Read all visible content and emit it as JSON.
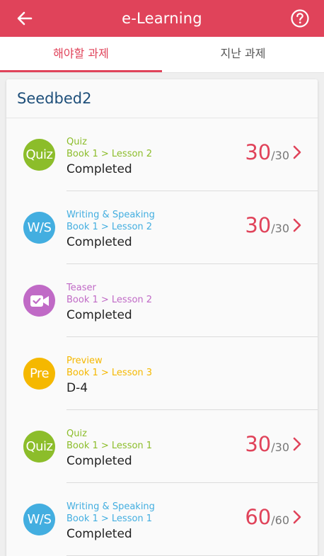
{
  "header": {
    "title": "e-Learning",
    "back_icon": "arrow-left-icon",
    "help_icon": "help-circle-icon",
    "color": "#e0435a"
  },
  "tabs": [
    {
      "label": "해야할 과제",
      "active": true
    },
    {
      "label": "지난 과제",
      "active": false
    }
  ],
  "course": {
    "title": "Seedbed2"
  },
  "items": [
    {
      "icon_text": "Quiz",
      "icon_color": "#8cbd2a",
      "category": "Quiz",
      "path": "Book 1 > Lesson 2",
      "status": "Completed",
      "score": "30",
      "total": "/30",
      "accent": "#8cbd2a"
    },
    {
      "icon_text": "W/S",
      "icon_color": "#43aee0",
      "category": "Writing & Speaking",
      "path": "Book 1 > Lesson 2",
      "status": "Completed",
      "score": "30",
      "total": "/30",
      "accent": "#43aee0"
    },
    {
      "icon_text": "",
      "icon_name": "video-check-icon",
      "icon_color": "#c06ac6",
      "category": "Teaser",
      "path": "Book 1 > Lesson 2",
      "status": "Completed",
      "score": "",
      "total": "",
      "accent": "#c06ac6"
    },
    {
      "icon_text": "Pre",
      "icon_color": "#f5b800",
      "category": "Preview",
      "path": "Book 1 > Lesson 3",
      "status": "D-4",
      "score": "",
      "total": "",
      "accent": "#f5b800"
    },
    {
      "icon_text": "Quiz",
      "icon_color": "#8cbd2a",
      "category": "Quiz",
      "path": "Book 1 > Lesson 1",
      "status": "Completed",
      "score": "30",
      "total": "/30",
      "accent": "#8cbd2a"
    },
    {
      "icon_text": "W/S",
      "icon_color": "#43aee0",
      "category": "Writing & Speaking",
      "path": "Book 1 > Lesson 1",
      "status": "Completed",
      "score": "60",
      "total": "/60",
      "accent": "#43aee0"
    }
  ]
}
